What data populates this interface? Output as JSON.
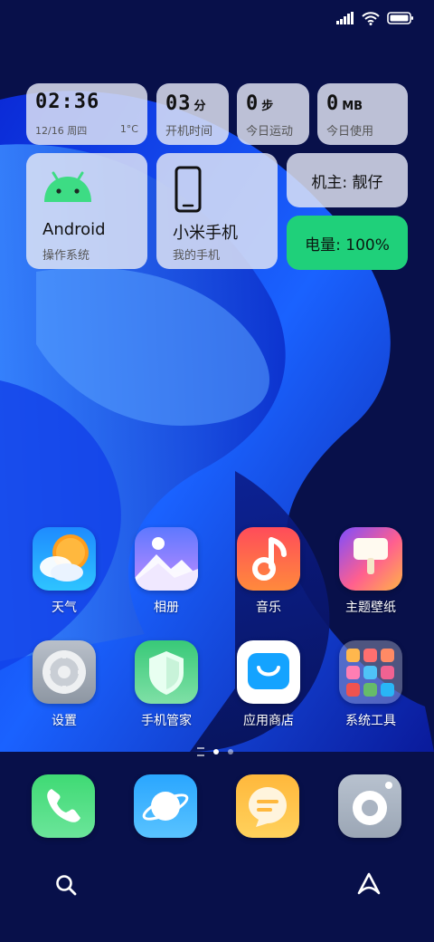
{
  "status_bar": {
    "signal_icon": "signal-icon",
    "wifi_icon": "wifi-icon",
    "battery_icon": "battery-icon"
  },
  "widgets": {
    "clock": {
      "time": "02:36",
      "date": "12/16 周四",
      "temp": "1°C"
    },
    "uptime": {
      "value": "03",
      "unit": "分",
      "label": "开机时间"
    },
    "steps": {
      "value": "0",
      "unit": "步",
      "label": "今日运动"
    },
    "data_usage": {
      "value": "0",
      "unit": "MB",
      "label": "今日使用"
    },
    "os": {
      "name": "Android",
      "label": "操作系统",
      "icon": "android-icon",
      "color": "#3ddc84"
    },
    "phone": {
      "name": "小米手机",
      "label": "我的手机",
      "icon": "phone-icon"
    },
    "owner": {
      "text": "机主: 靓仔"
    },
    "battery": {
      "text": "电量: 100%",
      "color": "#1fd07a"
    }
  },
  "apps": [
    {
      "label": "天气",
      "icon": "weather-icon"
    },
    {
      "label": "相册",
      "icon": "gallery-icon"
    },
    {
      "label": "音乐",
      "icon": "music-icon"
    },
    {
      "label": "主题壁纸",
      "icon": "theme-icon"
    },
    {
      "label": "设置",
      "icon": "settings-gear-icon"
    },
    {
      "label": "手机管家",
      "icon": "shield-icon"
    },
    {
      "label": "应用商店",
      "icon": "app-store-icon"
    },
    {
      "label": "系统工具",
      "icon": "tools-folder-icon"
    }
  ],
  "page_indicator": {
    "pages": 3,
    "current": 1
  },
  "dock": [
    {
      "icon": "phone-call-icon"
    },
    {
      "icon": "browser-planet-icon"
    },
    {
      "icon": "messages-icon"
    },
    {
      "icon": "camera-icon"
    }
  ],
  "bottom_bar": {
    "left_icon": "search-icon",
    "right_icon": "assistant-icon"
  }
}
